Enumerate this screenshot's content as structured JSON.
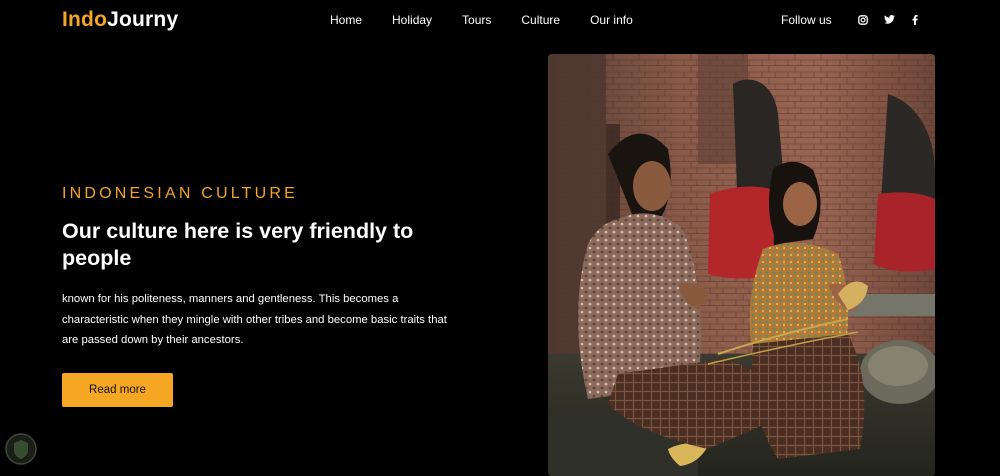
{
  "brand": {
    "part1": "Indo",
    "part2": "Journy",
    "accent_color": "#f5a623"
  },
  "nav": {
    "items": [
      {
        "label": "Home"
      },
      {
        "label": "Holiday"
      },
      {
        "label": "Tours"
      },
      {
        "label": "Culture"
      },
      {
        "label": "Our info"
      }
    ]
  },
  "social": {
    "label": "Follow us",
    "icons": [
      "instagram-icon",
      "twitter-icon",
      "facebook-icon"
    ]
  },
  "hero": {
    "eyebrow": "INDONESIAN CULTURE",
    "headline": "Our culture here is very friendly to people",
    "description": "known for his politeness, manners and gentleness. This becomes a characteristic when they mingle with other tribes and become basic traits that are passed down by their ancestors.",
    "cta_label": "Read more"
  }
}
